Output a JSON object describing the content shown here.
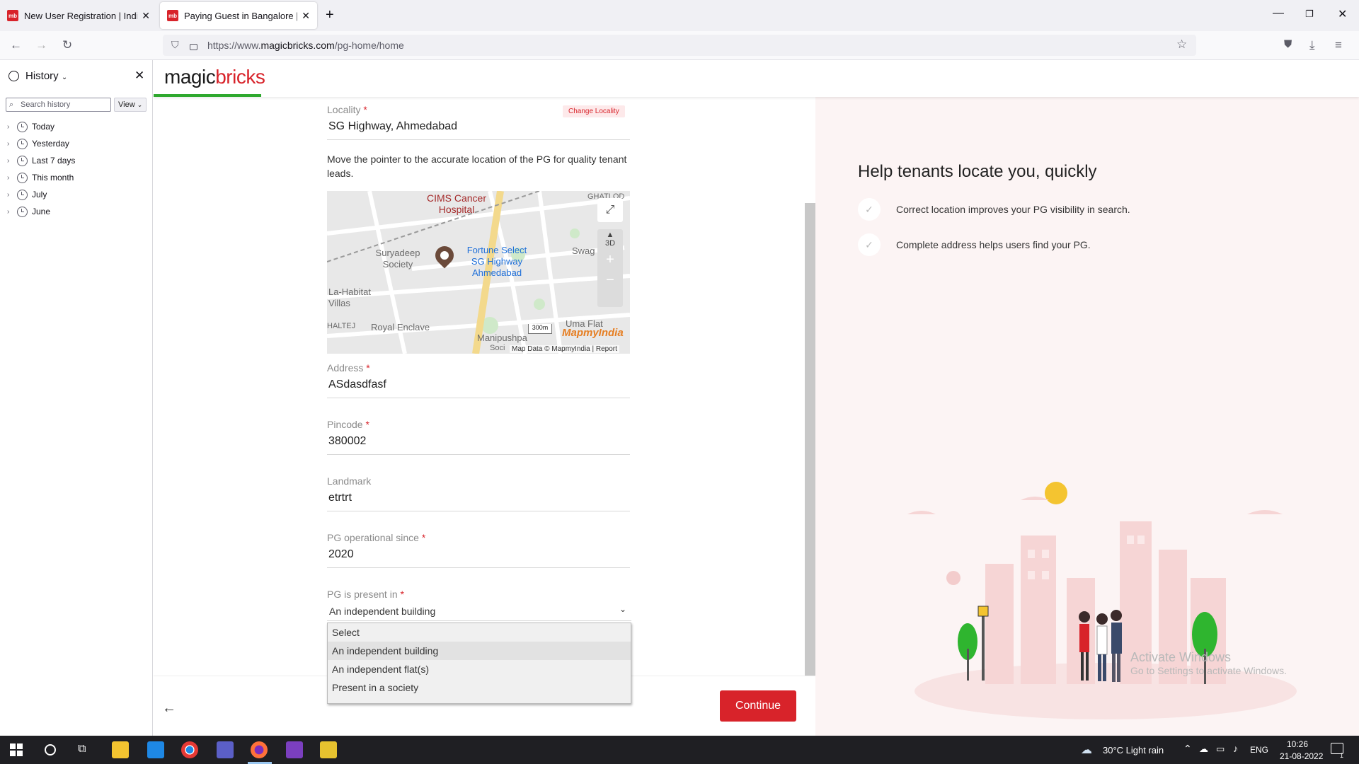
{
  "browser": {
    "tabs": [
      {
        "favicon": "mb",
        "title": "New User Registration | Individual"
      },
      {
        "favicon": "mb",
        "title": "Paying Guest in Bangalore | Real"
      }
    ],
    "url_prefix": "https://www.",
    "url_domain": "magicbricks.com",
    "url_path": "/pg-home/home"
  },
  "sidebar": {
    "title": "History",
    "search_placeholder": "Search history",
    "view_label": "View",
    "items": [
      "Today",
      "Yesterday",
      "Last 7 days",
      "This month",
      "July",
      "June"
    ]
  },
  "site": {
    "logo_part1": "magic",
    "logo_part2": "bricks"
  },
  "form": {
    "locality_label": "Locality",
    "locality_value": "SG Highway, Ahmedabad",
    "change_locality": "Change Locality",
    "move_pointer_text": "Move the pointer to the accurate location of the PG for quality tenant leads.",
    "map": {
      "labels": [
        "CIMS Cancer Hospital",
        "GHATLOD",
        "Suryadeep Society",
        "Fortune Select SG Highway Ahmedabad",
        "Swag",
        "La-Habitat Villas",
        "HALTEJ",
        "Royal Enclave",
        "Manipushpa",
        "Uma Flat",
        "Soci"
      ],
      "scale": "300m",
      "brand": "MapmyIndia",
      "attribution": "Map Data © MapmyIndia | Report",
      "btn_3d": "3D"
    },
    "address_label": "Address",
    "address_value": "ASdasdfasf",
    "pincode_label": "Pincode",
    "pincode_value": "380002",
    "landmark_label": "Landmark",
    "landmark_value": "etrtrt",
    "operational_label": "PG operational since",
    "operational_value": "2020",
    "present_label": "PG is present in",
    "present_value": "An independent building",
    "present_options": [
      "Select",
      "An independent building",
      "An independent flat(s)",
      "Present in a society"
    ],
    "continue_label": "Continue"
  },
  "help": {
    "title": "Help tenants locate you, quickly",
    "points": [
      "Correct location improves your PG visibility in search.",
      "Complete address helps users find your PG."
    ]
  },
  "watermark": {
    "line1": "Activate Windows",
    "line2": "Go to Settings to activate Windows."
  },
  "taskbar": {
    "weather": "30°C  Light rain",
    "lang": "ENG",
    "time": "10:26",
    "date": "21-08-2022",
    "notifications": "1"
  },
  "colors": {
    "brand_red": "#d8232a",
    "brand_green": "#2ea82e"
  }
}
